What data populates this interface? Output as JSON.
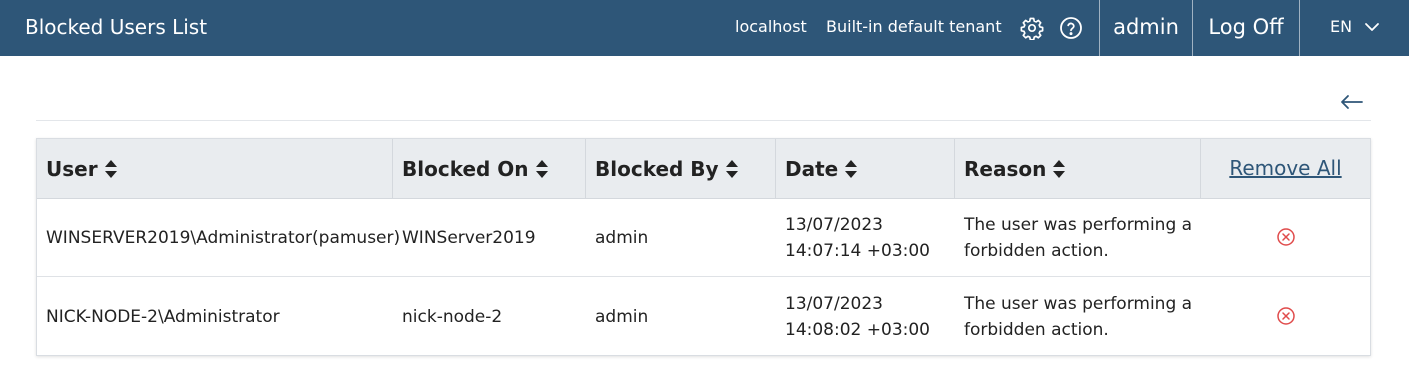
{
  "header": {
    "title": "Blocked Users List",
    "host": "localhost",
    "tenant": "Built-in default tenant",
    "user": "admin",
    "logoff_label": "Log Off",
    "language": "EN"
  },
  "icons": {
    "settings": "gear-icon",
    "help": "help-circle-icon",
    "language_dropdown": "chevron-down-icon",
    "back": "arrow-left-icon",
    "sort": "sort-icon",
    "remove": "remove-circle-icon"
  },
  "colors": {
    "topbar": "#2e5678",
    "header_row": "#e9ecef",
    "remove_icon": "#e04b4b",
    "link": "#2e5678"
  },
  "table": {
    "columns": [
      "User",
      "Blocked On",
      "Blocked By",
      "Date",
      "Reason"
    ],
    "remove_all_label": "Remove All",
    "rows": [
      {
        "user": "WINSERVER2019\\Administrator(pamuser)",
        "blocked_on": "WINServer2019",
        "blocked_by": "admin",
        "date_line1": "13/07/2023",
        "date_line2": "14:07:14 +03:00",
        "reason_line1": "The user was performing a",
        "reason_line2": "forbidden action."
      },
      {
        "user": "NICK-NODE-2\\Administrator",
        "blocked_on": "nick-node-2",
        "blocked_by": "admin",
        "date_line1": "13/07/2023",
        "date_line2": "14:08:02 +03:00",
        "reason_line1": "The user was performing a",
        "reason_line2": "forbidden action."
      }
    ]
  }
}
